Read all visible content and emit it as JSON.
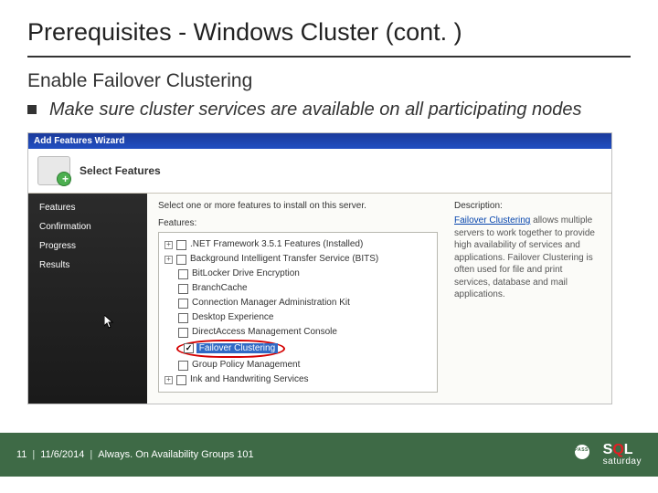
{
  "slide": {
    "title": "Prerequisites - Windows Cluster (cont. )",
    "subtitle": "Enable Failover Clustering",
    "bullet": "Make sure cluster services are available on all participating nodes"
  },
  "wizard": {
    "window_title": "Add Features Wizard",
    "header": "Select Features",
    "sidebar": [
      "Features",
      "Confirmation",
      "Progress",
      "Results"
    ],
    "instruction": "Select one or more features to install on this server.",
    "features_label": "Features:",
    "tree": {
      "net": ".NET Framework 3.5.1 Features  (Installed)",
      "bits": "Background Intelligent Transfer Service (BITS)",
      "bitlocker": "BitLocker Drive Encryption",
      "branch": "BranchCache",
      "cmak": "Connection Manager Administration Kit",
      "desktop": "Desktop Experience",
      "damc": "DirectAccess Management Console",
      "failover": "Failover Clustering",
      "gpm": "Group Policy Management",
      "ink": "Ink and Handwriting Services"
    },
    "desc_label": "Description:",
    "desc_link": "Failover Clustering",
    "desc_text": " allows multiple servers to work together to provide high availability of services and applications. Failover Clustering is often used for file and print services, database and mail applications."
  },
  "footer": {
    "page": "11",
    "date": "11/6/2014",
    "title": "Always. On Availability Groups 101"
  },
  "logo": {
    "sql_s": "S",
    "sql_q": "Q",
    "sql_l": "L",
    "saturday": "saturday",
    "pass": "PASS"
  }
}
